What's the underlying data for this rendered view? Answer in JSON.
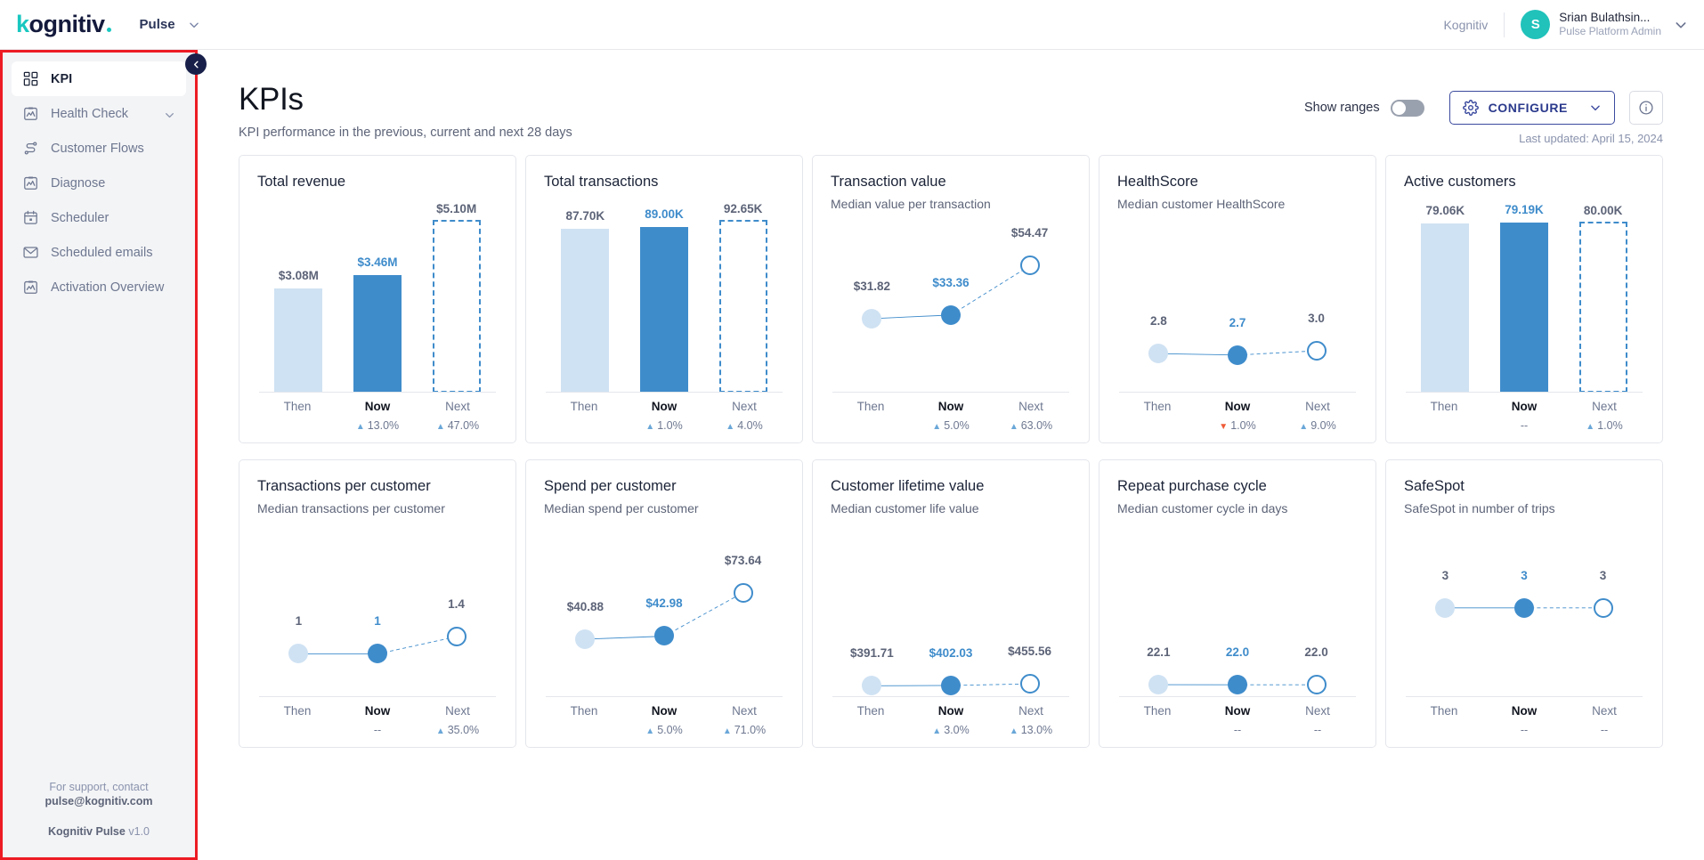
{
  "header": {
    "logo_text": "kognitiv",
    "app_name": "Pulse",
    "tenant": "Kognitiv",
    "avatar_initial": "S",
    "user_name": "Srian Bulathsin...",
    "user_role": "Pulse Platform Admin"
  },
  "sidebar": {
    "items": [
      {
        "label": "KPI",
        "icon": "grid-icon",
        "active": true,
        "chevron": false
      },
      {
        "label": "Health Check",
        "icon": "chart-clipboard-icon",
        "active": false,
        "chevron": true
      },
      {
        "label": "Customer Flows",
        "icon": "flow-icon",
        "active": false,
        "chevron": false
      },
      {
        "label": "Diagnose",
        "icon": "chart-clipboard-icon",
        "active": false,
        "chevron": false
      },
      {
        "label": "Scheduler",
        "icon": "calendar-icon",
        "active": false,
        "chevron": false
      },
      {
        "label": "Scheduled emails",
        "icon": "envelope-icon",
        "active": false,
        "chevron": false
      },
      {
        "label": "Activation Overview",
        "icon": "chart-clipboard-icon",
        "active": false,
        "chevron": false
      }
    ],
    "footer": {
      "support_line1": "For support, contact",
      "support_line2": "pulse@kognitiv.com",
      "product": "Kognitiv Pulse",
      "version": "v1.0"
    }
  },
  "page": {
    "title": "KPIs",
    "subtitle": "KPI performance in the previous, current and next 28 days",
    "show_ranges_label": "Show ranges",
    "show_ranges_on": false,
    "configure_label": "CONFIGURE",
    "last_updated": "Last updated: April 15, 2024"
  },
  "colors": {
    "then": "#cfe2f3",
    "now": "#3f8ccb",
    "next_outline": "#3f8ccb",
    "up": "#6aa7d8",
    "down": "#ef5b37",
    "brand_navy": "#141a3c",
    "brand_teal": "#18c7c0",
    "accent_indigo": "#3b4a9e"
  },
  "period_labels": {
    "then": "Then",
    "now": "Now",
    "next": "Next"
  },
  "chart_data": [
    {
      "id": "total-revenue",
      "type": "bar",
      "title": "Total revenue",
      "subtitle": "",
      "categories": [
        "Then",
        "Now",
        "Next"
      ],
      "labels": [
        "$3.08M",
        "$3.46M",
        "$5.10M"
      ],
      "values": [
        3.08,
        3.46,
        5.1
      ],
      "ylim": [
        0,
        5.95
      ],
      "deltas": [
        "13.0%",
        "47.0%"
      ],
      "delta_dirs": [
        "up",
        "up"
      ]
    },
    {
      "id": "total-transactions",
      "type": "bar",
      "title": "Total transactions",
      "subtitle": "",
      "categories": [
        "Then",
        "Now",
        "Next"
      ],
      "labels": [
        "87.70K",
        "89.00K",
        "92.65K"
      ],
      "values": [
        87.7,
        89.0,
        92.65
      ],
      "ylim": [
        0,
        108
      ],
      "deltas": [
        "1.0%",
        "4.0%"
      ],
      "delta_dirs": [
        "up",
        "up"
      ]
    },
    {
      "id": "transaction-value",
      "type": "line",
      "title": "Transaction value",
      "subtitle": "Median value per transaction",
      "categories": [
        "Then",
        "Now",
        "Next"
      ],
      "labels": [
        "$31.82",
        "$33.36",
        "$54.47"
      ],
      "values": [
        31.82,
        33.36,
        54.47
      ],
      "ylim": [
        0,
        78
      ],
      "deltas": [
        "5.0%",
        "63.0%"
      ],
      "delta_dirs": [
        "up",
        "up"
      ]
    },
    {
      "id": "healthscore",
      "type": "line",
      "title": "HealthScore",
      "subtitle": "Median customer HealthScore",
      "categories": [
        "Then",
        "Now",
        "Next"
      ],
      "labels": [
        "2.8",
        "2.7",
        "3.0"
      ],
      "values": [
        2.8,
        2.7,
        3.0
      ],
      "ylim": [
        0,
        13
      ],
      "deltas": [
        "1.0%",
        "9.0%"
      ],
      "delta_dirs": [
        "down",
        "up"
      ]
    },
    {
      "id": "active-customers",
      "type": "bar",
      "title": "Active customers",
      "subtitle": "",
      "categories": [
        "Then",
        "Now",
        "Next"
      ],
      "labels": [
        "79.06K",
        "79.19K",
        "80.00K"
      ],
      "values": [
        79.06,
        79.19,
        80.0
      ],
      "ylim": [
        0,
        94
      ],
      "deltas": [
        "--",
        "1.0%"
      ],
      "delta_dirs": [
        "none",
        "up"
      ]
    },
    {
      "id": "transactions-per-customer",
      "type": "line",
      "title": "Transactions per customer",
      "subtitle": "Median transactions per customer",
      "categories": [
        "Then",
        "Now",
        "Next"
      ],
      "labels": [
        "1",
        "1",
        "1.4"
      ],
      "values": [
        1,
        1,
        1.4
      ],
      "ylim": [
        0,
        4.2
      ],
      "deltas": [
        "--",
        "35.0%"
      ],
      "delta_dirs": [
        "none",
        "up"
      ]
    },
    {
      "id": "spend-per-customer",
      "type": "line",
      "title": "Spend per customer",
      "subtitle": "Median spend per customer",
      "categories": [
        "Then",
        "Now",
        "Next"
      ],
      "labels": [
        "$40.88",
        "$42.98",
        "$73.64"
      ],
      "values": [
        40.88,
        42.98,
        73.64
      ],
      "ylim": [
        0,
        128
      ],
      "deltas": [
        "5.0%",
        "71.0%"
      ],
      "delta_dirs": [
        "up",
        "up"
      ]
    },
    {
      "id": "customer-lifetime-value",
      "type": "line",
      "title": "Customer lifetime value",
      "subtitle": "Median customer life value",
      "categories": [
        "Then",
        "Now",
        "Next"
      ],
      "labels": [
        "$391.71",
        "$402.03",
        "$455.56"
      ],
      "values": [
        391.71,
        402.03,
        455.56
      ],
      "ylim": [
        0,
        6200
      ],
      "deltas": [
        "3.0%",
        "13.0%"
      ],
      "delta_dirs": [
        "up",
        "up"
      ]
    },
    {
      "id": "repeat-purchase-cycle",
      "type": "line",
      "title": "Repeat purchase cycle",
      "subtitle": "Median customer cycle in days",
      "categories": [
        "Then",
        "Now",
        "Next"
      ],
      "labels": [
        "22.1",
        "22.0",
        "22.0"
      ],
      "values": [
        22.1,
        22.0,
        22.0
      ],
      "ylim": [
        0,
        320
      ],
      "deltas": [
        "--",
        "--"
      ],
      "delta_dirs": [
        "none",
        "none"
      ]
    },
    {
      "id": "safespot",
      "type": "line",
      "title": "SafeSpot",
      "subtitle": "SafeSpot in number of trips",
      "categories": [
        "Then",
        "Now",
        "Next"
      ],
      "labels": [
        "3",
        "3",
        "3"
      ],
      "values": [
        3,
        3,
        3
      ],
      "ylim": [
        0,
        6.1
      ],
      "deltas": [
        "--",
        "--"
      ],
      "delta_dirs": [
        "none",
        "none"
      ]
    }
  ]
}
